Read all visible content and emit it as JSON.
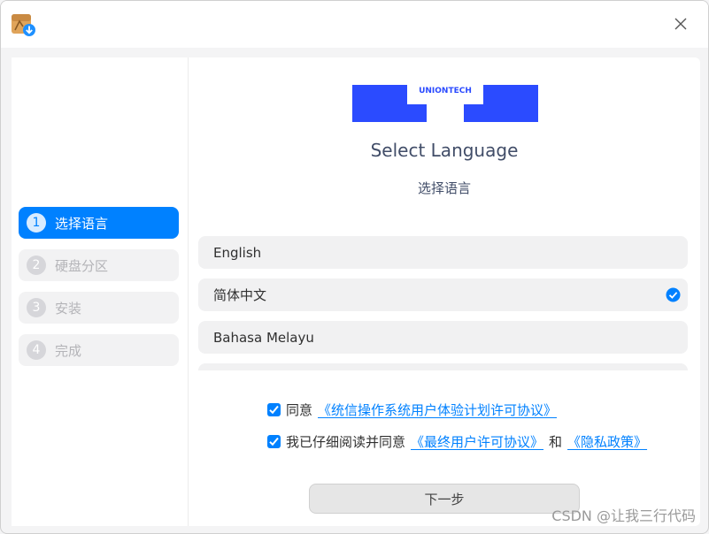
{
  "brand": {
    "logo_text": "UNIONTECH",
    "accent": "#0081ff",
    "logo_color": "#2b4bff"
  },
  "titlebar": {
    "icon": "package-download-icon",
    "close_icon": "close-icon"
  },
  "sidebar": {
    "steps": [
      {
        "number": "1",
        "label": "选择语言",
        "active": true
      },
      {
        "number": "2",
        "label": "硬盘分区",
        "active": false
      },
      {
        "number": "3",
        "label": "安装",
        "active": false
      },
      {
        "number": "4",
        "label": "完成",
        "active": false
      }
    ]
  },
  "main": {
    "title": "Select Language",
    "subtitle": "选择语言",
    "languages": [
      {
        "name": "English",
        "selected": false
      },
      {
        "name": "简体中文",
        "selected": true
      },
      {
        "name": "Bahasa Melayu",
        "selected": false
      }
    ],
    "agreement1": {
      "prefix": "同意",
      "link": "《统信操作系统用户体验计划许可协议》",
      "checked": true
    },
    "agreement2": {
      "prefix": "我已仔细阅读并同意",
      "link1": "《最终用户许可协议》",
      "middle": "和",
      "link2": "《隐私政策》",
      "checked": true
    },
    "next_button": "下一步"
  },
  "watermark": "CSDN @让我三行代码"
}
